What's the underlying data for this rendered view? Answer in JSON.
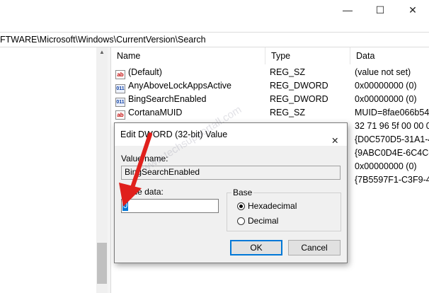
{
  "window": {
    "min_icon": "minimize-icon",
    "max_icon": "maximize-icon",
    "close_icon": "close-icon",
    "min_glyph": "—",
    "max_glyph": "☐",
    "close_glyph": "✕"
  },
  "address": {
    "path": "FTWARE\\Microsoft\\Windows\\CurrentVersion\\Search"
  },
  "columns": {
    "name": "Name",
    "type": "Type",
    "data": "Data"
  },
  "rows": [
    {
      "icon": "string-value-icon",
      "glyph": "ab",
      "name": "(Default)",
      "type": "REG_SZ",
      "data": "(value not set)"
    },
    {
      "icon": "binary-value-icon",
      "glyph": "011",
      "name": "AnyAboveLockAppsActive",
      "type": "REG_DWORD",
      "data": "0x00000000 (0)"
    },
    {
      "icon": "binary-value-icon",
      "glyph": "011",
      "name": "BingSearchEnabled",
      "type": "REG_DWORD",
      "data": "0x00000000 (0)"
    },
    {
      "icon": "string-value-icon",
      "glyph": "ab",
      "name": "CortanaMUID",
      "type": "REG_SZ",
      "data": "MUID=8fae066b54b"
    },
    {
      "icon": "binary-value-icon",
      "glyph": "",
      "name": "",
      "type": "",
      "data": "32 71 96 5f 00 00 00"
    },
    {
      "icon": "",
      "glyph": "",
      "name": "",
      "type": "",
      "data": "{D0C570D5-31A1-4"
    },
    {
      "icon": "",
      "glyph": "",
      "name": "",
      "type": "",
      "data": "{9ABC0D4E-6C4C-4"
    },
    {
      "icon": "",
      "glyph": "",
      "name": "",
      "type": "",
      "data": "0x00000000 (0)"
    },
    {
      "icon": "",
      "glyph": "",
      "name": "",
      "type": "",
      "data": "{7B5597F1-C3F9-4A"
    }
  ],
  "dialog": {
    "title": "Edit DWORD (32-bit) Value",
    "close_glyph": "✕",
    "value_name_label": "Value name:",
    "value_name": "BingSearchEnabled",
    "value_data_label": "Value data:",
    "value_data": "0",
    "base_label": "Base",
    "hex_label": "Hexadecimal",
    "dec_label": "Decimal",
    "base_selected": "Hexadecimal",
    "ok_label": "OK",
    "cancel_label": "Cancel"
  },
  "watermark": "www.techsupportall.com",
  "colors": {
    "accent": "#0078d7",
    "annotation_arrow": "#e0201c"
  }
}
